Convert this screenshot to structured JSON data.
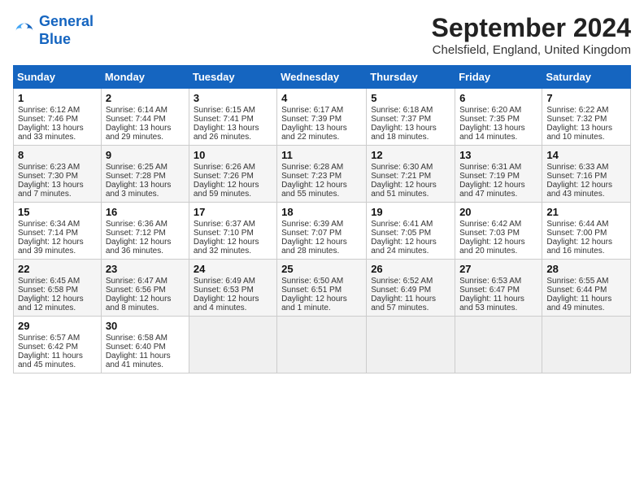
{
  "header": {
    "logo_line1": "General",
    "logo_line2": "Blue",
    "month": "September 2024",
    "location": "Chelsfield, England, United Kingdom"
  },
  "days_of_week": [
    "Sunday",
    "Monday",
    "Tuesday",
    "Wednesday",
    "Thursday",
    "Friday",
    "Saturday"
  ],
  "weeks": [
    [
      {
        "day": "1",
        "lines": [
          "Sunrise: 6:12 AM",
          "Sunset: 7:46 PM",
          "Daylight: 13 hours",
          "and 33 minutes."
        ]
      },
      {
        "day": "2",
        "lines": [
          "Sunrise: 6:14 AM",
          "Sunset: 7:44 PM",
          "Daylight: 13 hours",
          "and 29 minutes."
        ]
      },
      {
        "day": "3",
        "lines": [
          "Sunrise: 6:15 AM",
          "Sunset: 7:41 PM",
          "Daylight: 13 hours",
          "and 26 minutes."
        ]
      },
      {
        "day": "4",
        "lines": [
          "Sunrise: 6:17 AM",
          "Sunset: 7:39 PM",
          "Daylight: 13 hours",
          "and 22 minutes."
        ]
      },
      {
        "day": "5",
        "lines": [
          "Sunrise: 6:18 AM",
          "Sunset: 7:37 PM",
          "Daylight: 13 hours",
          "and 18 minutes."
        ]
      },
      {
        "day": "6",
        "lines": [
          "Sunrise: 6:20 AM",
          "Sunset: 7:35 PM",
          "Daylight: 13 hours",
          "and 14 minutes."
        ]
      },
      {
        "day": "7",
        "lines": [
          "Sunrise: 6:22 AM",
          "Sunset: 7:32 PM",
          "Daylight: 13 hours",
          "and 10 minutes."
        ]
      }
    ],
    [
      {
        "day": "8",
        "lines": [
          "Sunrise: 6:23 AM",
          "Sunset: 7:30 PM",
          "Daylight: 13 hours",
          "and 7 minutes."
        ]
      },
      {
        "day": "9",
        "lines": [
          "Sunrise: 6:25 AM",
          "Sunset: 7:28 PM",
          "Daylight: 13 hours",
          "and 3 minutes."
        ]
      },
      {
        "day": "10",
        "lines": [
          "Sunrise: 6:26 AM",
          "Sunset: 7:26 PM",
          "Daylight: 12 hours",
          "and 59 minutes."
        ]
      },
      {
        "day": "11",
        "lines": [
          "Sunrise: 6:28 AM",
          "Sunset: 7:23 PM",
          "Daylight: 12 hours",
          "and 55 minutes."
        ]
      },
      {
        "day": "12",
        "lines": [
          "Sunrise: 6:30 AM",
          "Sunset: 7:21 PM",
          "Daylight: 12 hours",
          "and 51 minutes."
        ]
      },
      {
        "day": "13",
        "lines": [
          "Sunrise: 6:31 AM",
          "Sunset: 7:19 PM",
          "Daylight: 12 hours",
          "and 47 minutes."
        ]
      },
      {
        "day": "14",
        "lines": [
          "Sunrise: 6:33 AM",
          "Sunset: 7:16 PM",
          "Daylight: 12 hours",
          "and 43 minutes."
        ]
      }
    ],
    [
      {
        "day": "15",
        "lines": [
          "Sunrise: 6:34 AM",
          "Sunset: 7:14 PM",
          "Daylight: 12 hours",
          "and 39 minutes."
        ]
      },
      {
        "day": "16",
        "lines": [
          "Sunrise: 6:36 AM",
          "Sunset: 7:12 PM",
          "Daylight: 12 hours",
          "and 36 minutes."
        ]
      },
      {
        "day": "17",
        "lines": [
          "Sunrise: 6:37 AM",
          "Sunset: 7:10 PM",
          "Daylight: 12 hours",
          "and 32 minutes."
        ]
      },
      {
        "day": "18",
        "lines": [
          "Sunrise: 6:39 AM",
          "Sunset: 7:07 PM",
          "Daylight: 12 hours",
          "and 28 minutes."
        ]
      },
      {
        "day": "19",
        "lines": [
          "Sunrise: 6:41 AM",
          "Sunset: 7:05 PM",
          "Daylight: 12 hours",
          "and 24 minutes."
        ]
      },
      {
        "day": "20",
        "lines": [
          "Sunrise: 6:42 AM",
          "Sunset: 7:03 PM",
          "Daylight: 12 hours",
          "and 20 minutes."
        ]
      },
      {
        "day": "21",
        "lines": [
          "Sunrise: 6:44 AM",
          "Sunset: 7:00 PM",
          "Daylight: 12 hours",
          "and 16 minutes."
        ]
      }
    ],
    [
      {
        "day": "22",
        "lines": [
          "Sunrise: 6:45 AM",
          "Sunset: 6:58 PM",
          "Daylight: 12 hours",
          "and 12 minutes."
        ]
      },
      {
        "day": "23",
        "lines": [
          "Sunrise: 6:47 AM",
          "Sunset: 6:56 PM",
          "Daylight: 12 hours",
          "and 8 minutes."
        ]
      },
      {
        "day": "24",
        "lines": [
          "Sunrise: 6:49 AM",
          "Sunset: 6:53 PM",
          "Daylight: 12 hours",
          "and 4 minutes."
        ]
      },
      {
        "day": "25",
        "lines": [
          "Sunrise: 6:50 AM",
          "Sunset: 6:51 PM",
          "Daylight: 12 hours",
          "and 1 minute."
        ]
      },
      {
        "day": "26",
        "lines": [
          "Sunrise: 6:52 AM",
          "Sunset: 6:49 PM",
          "Daylight: 11 hours",
          "and 57 minutes."
        ]
      },
      {
        "day": "27",
        "lines": [
          "Sunrise: 6:53 AM",
          "Sunset: 6:47 PM",
          "Daylight: 11 hours",
          "and 53 minutes."
        ]
      },
      {
        "day": "28",
        "lines": [
          "Sunrise: 6:55 AM",
          "Sunset: 6:44 PM",
          "Daylight: 11 hours",
          "and 49 minutes."
        ]
      }
    ],
    [
      {
        "day": "29",
        "lines": [
          "Sunrise: 6:57 AM",
          "Sunset: 6:42 PM",
          "Daylight: 11 hours",
          "and 45 minutes."
        ]
      },
      {
        "day": "30",
        "lines": [
          "Sunrise: 6:58 AM",
          "Sunset: 6:40 PM",
          "Daylight: 11 hours",
          "and 41 minutes."
        ]
      },
      {
        "day": "",
        "lines": []
      },
      {
        "day": "",
        "lines": []
      },
      {
        "day": "",
        "lines": []
      },
      {
        "day": "",
        "lines": []
      },
      {
        "day": "",
        "lines": []
      }
    ]
  ]
}
